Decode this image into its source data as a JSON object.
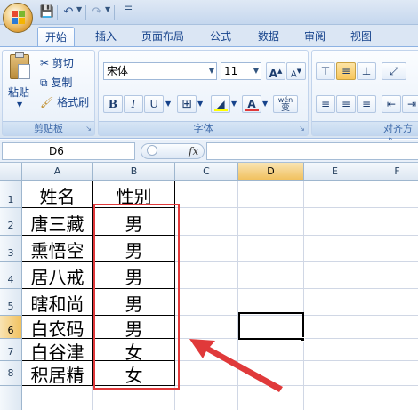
{
  "tabs": [
    "开始",
    "插入",
    "页面布局",
    "公式",
    "数据",
    "审阅",
    "视图"
  ],
  "active_tab": "开始",
  "clipboard": {
    "paste": "粘贴",
    "cut": "剪切",
    "copy": "复制",
    "format_painter": "格式刷",
    "group_label": "剪贴板"
  },
  "font": {
    "name": "宋体",
    "size": "11",
    "group_label": "字体",
    "bold": "B",
    "italic": "I",
    "underline": "U",
    "grow": "A",
    "shrink": "A",
    "color_letter": "A",
    "phonetic": "wén",
    "phonetic_char": "变"
  },
  "alignment": {
    "group_label": "对齐方式"
  },
  "formula_bar": {
    "name_box": "D6",
    "fx": "fx",
    "value": ""
  },
  "columns": [
    "A",
    "B",
    "C",
    "D",
    "E",
    "F"
  ],
  "rows": [
    "1",
    "2",
    "3",
    "4",
    "5",
    "6",
    "7",
    "8"
  ],
  "table": [
    [
      "姓名",
      "性别"
    ],
    [
      "唐三藏",
      "男"
    ],
    [
      "熏悟空",
      "男"
    ],
    [
      "居八戒",
      "男"
    ],
    [
      "瞎和尚",
      "男"
    ],
    [
      "白农码",
      "男"
    ],
    [
      "白谷津",
      "女"
    ],
    [
      "积居精",
      "女"
    ]
  ],
  "colors": {
    "highlight_border": "#e0393a",
    "accent": "#15428b"
  }
}
